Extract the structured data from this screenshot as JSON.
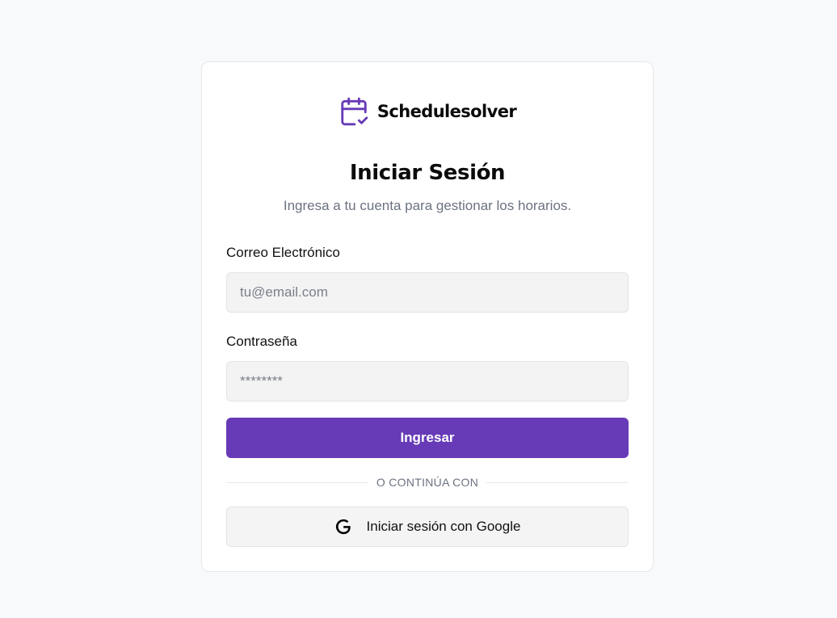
{
  "brand": {
    "name": "Schedulesolver",
    "icon": "calendar-check-icon",
    "accent_color": "#673ab7"
  },
  "login": {
    "title": "Iniciar Sesión",
    "subtitle": "Ingresa a tu cuenta para gestionar los horarios.",
    "email": {
      "label": "Correo Electrónico",
      "placeholder": "tu@email.com",
      "value": ""
    },
    "password": {
      "label": "Contraseña",
      "placeholder": "********",
      "value": ""
    },
    "submit_label": "Ingresar",
    "divider_text": "O CONTINÚA CON",
    "google": {
      "label": "Iniciar sesión con Google",
      "icon": "google-icon"
    }
  }
}
